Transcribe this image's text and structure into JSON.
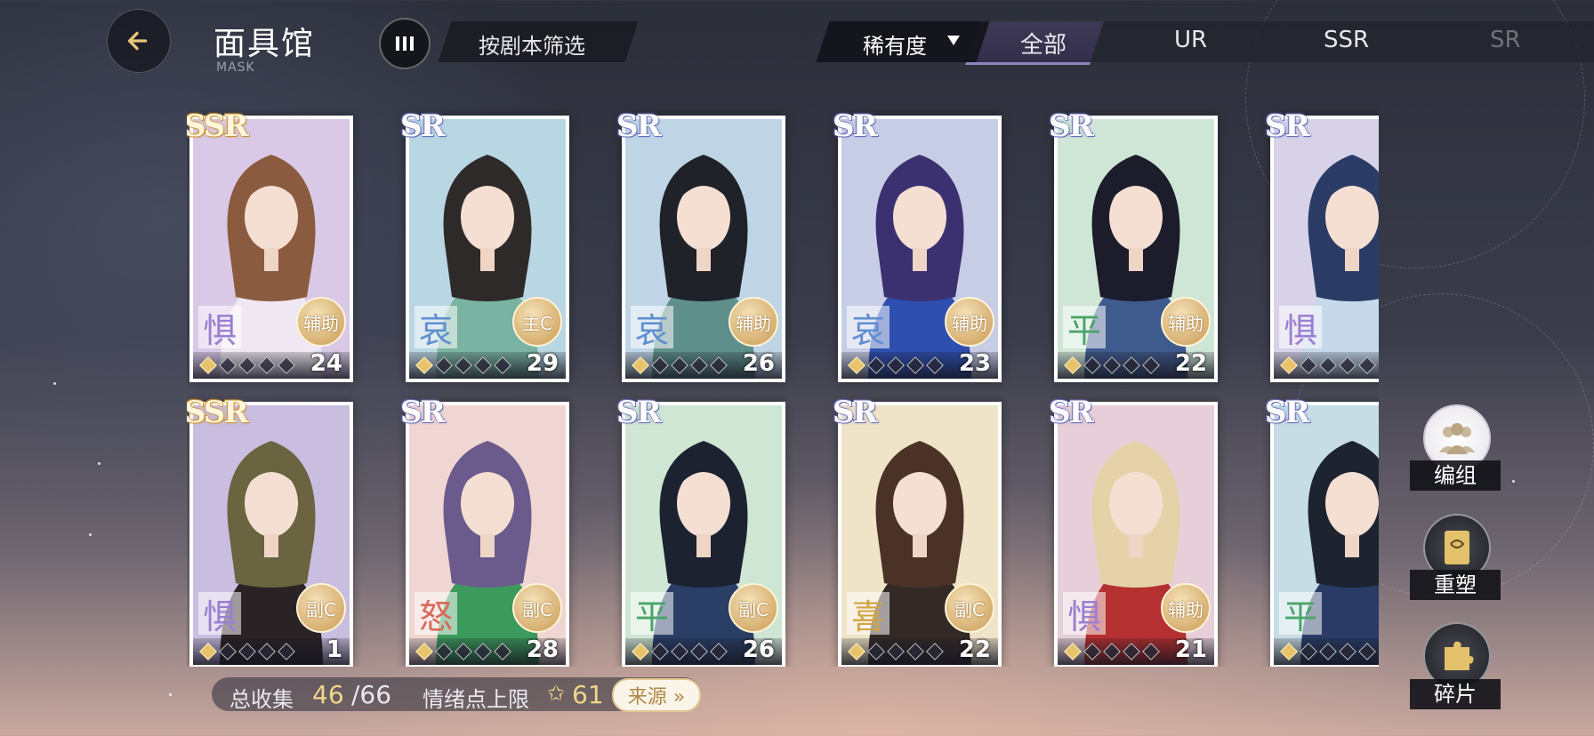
{
  "header": {
    "back_icon": "back-arrow-icon",
    "title": "面具馆",
    "subtitle": "MASK",
    "menu_icon": "menu-icon",
    "filter_label": "按剧本筛选"
  },
  "rarity_filter": {
    "dropdown_label": "稀有度",
    "tabs": [
      "全部",
      "UR",
      "SSR",
      "SR"
    ],
    "active_tab": "全部"
  },
  "cards": [
    {
      "rarity": "SSR",
      "emotion": "惧",
      "role": "辅助",
      "level": "24",
      "bg": "#d9c8e6",
      "hair": "#8a5b3e",
      "outfit": "#efe8f2"
    },
    {
      "rarity": "SR",
      "emotion": "哀",
      "role": "主C",
      "level": "29",
      "bg": "#b9d6e3",
      "hair": "#2f2a2a",
      "outfit": "#7ab3a1"
    },
    {
      "rarity": "SR",
      "emotion": "哀",
      "role": "辅助",
      "level": "26",
      "bg": "#bfd5e6",
      "hair": "#1f2228",
      "outfit": "#5f8f8a"
    },
    {
      "rarity": "SR",
      "emotion": "哀",
      "role": "辅助",
      "level": "23",
      "bg": "#c8cde6",
      "hair": "#3c3170",
      "outfit": "#2f4fb0"
    },
    {
      "rarity": "SR",
      "emotion": "平",
      "role": "辅助",
      "level": "22",
      "bg": "#cfe6d7",
      "hair": "#1c1c2a",
      "outfit": "#3f5a8c"
    },
    {
      "rarity": "SR",
      "emotion": "惧",
      "role": "",
      "level": "",
      "bg": "#d7d2e8",
      "hair": "#2a3c66",
      "outfit": "#c6d8ea"
    },
    {
      "rarity": "SSR",
      "emotion": "惧",
      "role": "副C",
      "level": "1",
      "bg": "#c9bde0",
      "hair": "#6a6440",
      "outfit": "#2a2326"
    },
    {
      "rarity": "SR",
      "emotion": "怒",
      "role": "副C",
      "level": "28",
      "bg": "#f0d6d2",
      "hair": "#6b5a8c",
      "outfit": "#3c9a5c"
    },
    {
      "rarity": "SR",
      "emotion": "平",
      "role": "副C",
      "level": "26",
      "bg": "#cfe6d4",
      "hair": "#1c2230",
      "outfit": "#2a3e66"
    },
    {
      "rarity": "SR",
      "emotion": "喜",
      "role": "副C",
      "level": "22",
      "bg": "#efe4c8",
      "hair": "#4a3226",
      "outfit": "#332a28"
    },
    {
      "rarity": "SR",
      "emotion": "惧",
      "role": "辅助",
      "level": "21",
      "bg": "#e6cfd8",
      "hair": "#e6d2a8",
      "outfit": "#b53030"
    },
    {
      "rarity": "SR",
      "emotion": "平",
      "role": "",
      "level": "",
      "bg": "#c6dde6",
      "hair": "#1e2330",
      "outfit": "#2a3c66"
    }
  ],
  "collection": {
    "label": "总收集",
    "collected": "46",
    "total": "/66",
    "emotion_label": "情绪点上限",
    "star_icon": "star-icon",
    "emotion_value": "61",
    "source_button": "来源 »"
  },
  "side_actions": [
    {
      "label": "编组",
      "icon": "team-icon"
    },
    {
      "label": "重塑",
      "icon": "card-remake-icon"
    },
    {
      "label": "碎片",
      "icon": "puzzle-piece-icon"
    }
  ]
}
